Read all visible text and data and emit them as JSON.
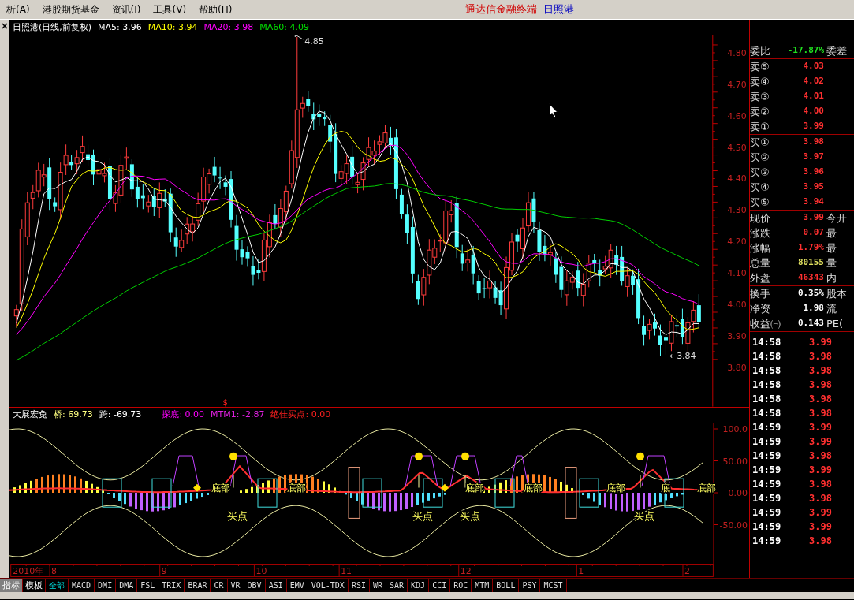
{
  "menu": {
    "items": [
      {
        "label": "析(A)"
      },
      {
        "label": "港股期货基金"
      },
      {
        "label": "资讯(I)"
      },
      {
        "label": "工具(V)"
      },
      {
        "label": "帮助(H)"
      }
    ],
    "app_title": "通达信金融终端",
    "stock_name": "日照港"
  },
  "price_chart": {
    "title": "日照港(日线,前复权)",
    "ma": [
      {
        "label": "MA5: 3.96",
        "color": "#ffffff"
      },
      {
        "label": "MA10: 3.94",
        "color": "#ffff00"
      },
      {
        "label": "MA20: 3.98",
        "color": "#ff00ff"
      },
      {
        "label": "MA60: 4.09",
        "color": "#00e000"
      }
    ],
    "y_axis": [
      "4.80",
      "4.70",
      "4.60",
      "4.50",
      "4.40",
      "4.30",
      "4.20",
      "4.10",
      "4.00",
      "3.90",
      "3.80"
    ],
    "high_label": "4.85",
    "low_label": "←3.84",
    "marker": "$"
  },
  "indicator": {
    "name": "大展宏兔",
    "values": [
      {
        "label": "桥: 69.73",
        "color": "#ffff80"
      },
      {
        "label": "跨: -69.73",
        "color": "#ffffff"
      },
      {
        "label": "探底: 0.00",
        "color": "#ff00ff"
      },
      {
        "label": "MTM1: -2.87",
        "color": "#e020e0"
      },
      {
        "label": "绝佳买点: 0.00",
        "color": "#ff2020"
      }
    ],
    "y_axis": [
      "100.0",
      "50.00",
      "0.00",
      "-50.00"
    ],
    "bottom_labels": [
      {
        "text": "底部"
      },
      {
        "text": "底部"
      },
      {
        "text": "底部"
      },
      {
        "text": "底部"
      },
      {
        "text": "底部"
      },
      {
        "text": "底"
      },
      {
        "text": "底部"
      }
    ],
    "buy_labels": [
      {
        "text": "买点"
      },
      {
        "text": "买点"
      },
      {
        "text": "买点"
      },
      {
        "text": "买点"
      }
    ]
  },
  "date_axis": {
    "year": "2010年",
    "months": [
      "8",
      "9",
      "10",
      "11",
      "12",
      "1",
      "2"
    ]
  },
  "mode_buttons": [
    {
      "label": "指标",
      "selected": true
    },
    {
      "label": "模板",
      "selected": false
    }
  ],
  "tabs": [
    {
      "label": "全部",
      "selected": true
    },
    {
      "label": "MACD",
      "selected": false
    },
    {
      "label": "DMI",
      "selected": false
    },
    {
      "label": "DMA",
      "selected": false
    },
    {
      "label": "FSL",
      "selected": false
    },
    {
      "label": "TRIX",
      "selected": false
    },
    {
      "label": "BRAR",
      "selected": false
    },
    {
      "label": "CR",
      "selected": false
    },
    {
      "label": "VR",
      "selected": false
    },
    {
      "label": "OBV",
      "selected": false
    },
    {
      "label": "ASI",
      "selected": false
    },
    {
      "label": "EMV",
      "selected": false
    },
    {
      "label": "VOL-TDX",
      "selected": false
    },
    {
      "label": "RSI",
      "selected": false
    },
    {
      "label": "WR",
      "selected": false
    },
    {
      "label": "SAR",
      "selected": false
    },
    {
      "label": "KDJ",
      "selected": false
    },
    {
      "label": "CCI",
      "selected": false
    },
    {
      "label": "ROC",
      "selected": false
    },
    {
      "label": "MTM",
      "selected": false
    },
    {
      "label": "BOLL",
      "selected": false
    },
    {
      "label": "PSY",
      "selected": false
    },
    {
      "label": "MCST",
      "selected": false
    }
  ],
  "quote": {
    "sections": [
      [
        {
          "label": "委比",
          "value": "-17.87%",
          "color": "#20e020",
          "extra": "委差"
        }
      ],
      [
        {
          "label": "卖⑤",
          "value": "4.03",
          "color": "#ff3030"
        },
        {
          "label": "卖④",
          "value": "4.02",
          "color": "#ff3030"
        },
        {
          "label": "卖③",
          "value": "4.01",
          "color": "#ff3030"
        },
        {
          "label": "卖②",
          "value": "4.00",
          "color": "#ff3030"
        },
        {
          "label": "卖①",
          "value": "3.99",
          "color": "#ff3030"
        }
      ],
      [
        {
          "label": "买①",
          "value": "3.98",
          "color": "#ff3030"
        },
        {
          "label": "买②",
          "value": "3.97",
          "color": "#ff3030"
        },
        {
          "label": "买③",
          "value": "3.96",
          "color": "#ff3030"
        },
        {
          "label": "买④",
          "value": "3.95",
          "color": "#ff3030"
        },
        {
          "label": "买⑤",
          "value": "3.94",
          "color": "#ff3030"
        }
      ],
      [
        {
          "label": "现价",
          "value": "3.99",
          "color": "#ff3030",
          "extra": "今开"
        },
        {
          "label": "涨跌",
          "value": "0.07",
          "color": "#ff3030",
          "extra": "最"
        },
        {
          "label": "涨幅",
          "value": "1.79%",
          "color": "#ff3030",
          "extra": "最"
        },
        {
          "label": "总量",
          "value": "80155",
          "color": "#e0e060",
          "extra": "量"
        },
        {
          "label": "外盘",
          "value": "46343",
          "color": "#ff3030",
          "extra": "内"
        }
      ],
      [
        {
          "label": "换手",
          "value": "0.35%",
          "color": "#ffffff",
          "extra": "股本"
        },
        {
          "label": "净资",
          "value": "1.98",
          "color": "#ffffff",
          "extra": "流"
        },
        {
          "label": "收益㈢",
          "value": "0.143",
          "color": "#ffffff",
          "extra": "PE("
        }
      ]
    ],
    "ticks": [
      {
        "time": "14:58",
        "price": "3.99"
      },
      {
        "time": "14:58",
        "price": "3.98"
      },
      {
        "time": "14:58",
        "price": "3.98"
      },
      {
        "time": "14:58",
        "price": "3.98"
      },
      {
        "time": "14:58",
        "price": "3.98"
      },
      {
        "time": "14:58",
        "price": "3.98"
      },
      {
        "time": "14:59",
        "price": "3.99"
      },
      {
        "time": "14:59",
        "price": "3.99"
      },
      {
        "time": "14:59",
        "price": "3.98"
      },
      {
        "time": "14:59",
        "price": "3.99"
      },
      {
        "time": "14:59",
        "price": "3.98"
      },
      {
        "time": "14:59",
        "price": "3.98"
      },
      {
        "time": "14:59",
        "price": "3.99"
      },
      {
        "time": "14:59",
        "price": "3.99"
      },
      {
        "time": "14:59",
        "price": "3.98"
      }
    ]
  }
}
